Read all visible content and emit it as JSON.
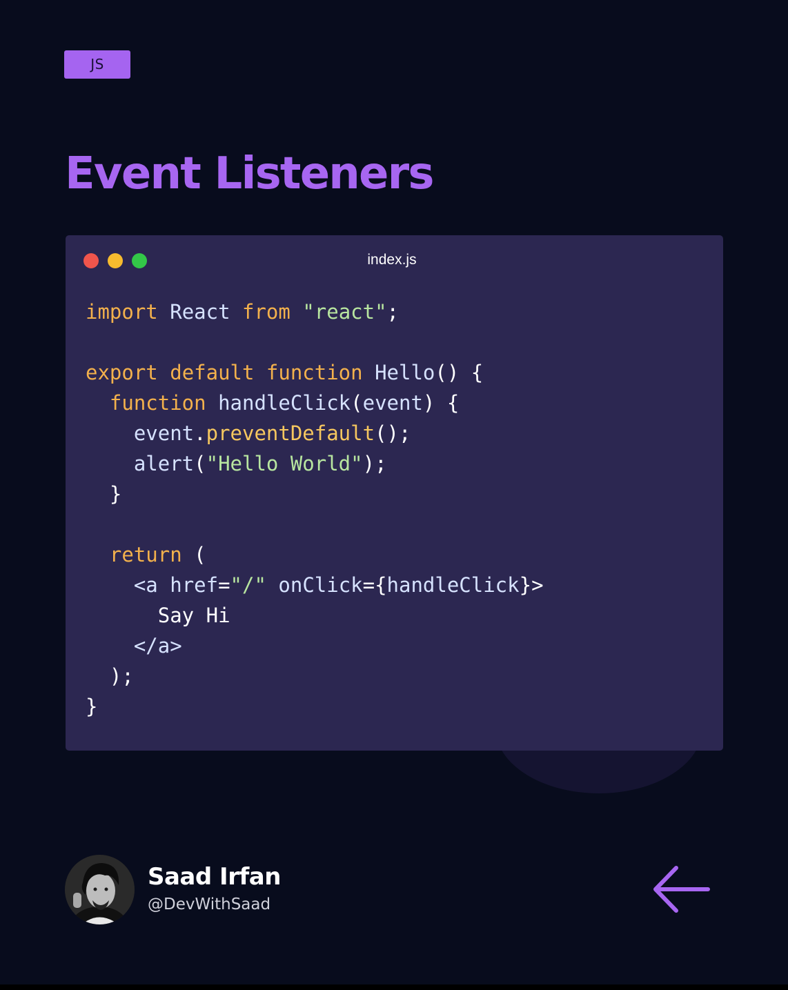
{
  "tag": {
    "label": "JS"
  },
  "title": "Event Listeners",
  "editor": {
    "file_name": "index.js",
    "lines": [
      [
        {
          "t": "import",
          "c": "kw"
        },
        {
          "t": " ",
          "c": "id"
        },
        {
          "t": "React",
          "c": "id"
        },
        {
          "t": " ",
          "c": "id"
        },
        {
          "t": "from",
          "c": "kw"
        },
        {
          "t": " ",
          "c": "id"
        },
        {
          "t": "\"react\"",
          "c": "str"
        },
        {
          "t": ";",
          "c": "punct"
        }
      ],
      [],
      [
        {
          "t": "export",
          "c": "kw"
        },
        {
          "t": " ",
          "c": "id"
        },
        {
          "t": "default",
          "c": "kw"
        },
        {
          "t": " ",
          "c": "id"
        },
        {
          "t": "function",
          "c": "kw"
        },
        {
          "t": " ",
          "c": "id"
        },
        {
          "t": "Hello",
          "c": "id"
        },
        {
          "t": "() {",
          "c": "punct"
        }
      ],
      [
        {
          "t": "  ",
          "c": "id"
        },
        {
          "t": "function",
          "c": "kw"
        },
        {
          "t": " ",
          "c": "id"
        },
        {
          "t": "handleClick",
          "c": "id"
        },
        {
          "t": "(",
          "c": "punct"
        },
        {
          "t": "event",
          "c": "id"
        },
        {
          "t": ") {",
          "c": "punct"
        }
      ],
      [
        {
          "t": "    ",
          "c": "id"
        },
        {
          "t": "event",
          "c": "id"
        },
        {
          "t": ".",
          "c": "punct"
        },
        {
          "t": "preventDefault",
          "c": "fn"
        },
        {
          "t": "();",
          "c": "punct"
        }
      ],
      [
        {
          "t": "    ",
          "c": "id"
        },
        {
          "t": "alert",
          "c": "id"
        },
        {
          "t": "(",
          "c": "punct"
        },
        {
          "t": "\"Hello World\"",
          "c": "str"
        },
        {
          "t": ");",
          "c": "punct"
        }
      ],
      [
        {
          "t": "  }",
          "c": "punct"
        }
      ],
      [],
      [
        {
          "t": "  ",
          "c": "id"
        },
        {
          "t": "return",
          "c": "kw"
        },
        {
          "t": " (",
          "c": "punct"
        }
      ],
      [
        {
          "t": "    ",
          "c": "id"
        },
        {
          "t": "<a",
          "c": "id"
        },
        {
          "t": " ",
          "c": "id"
        },
        {
          "t": "href",
          "c": "id"
        },
        {
          "t": "=",
          "c": "punct"
        },
        {
          "t": "\"/\"",
          "c": "str"
        },
        {
          "t": " ",
          "c": "id"
        },
        {
          "t": "onClick",
          "c": "id"
        },
        {
          "t": "={",
          "c": "punct"
        },
        {
          "t": "handleClick",
          "c": "id"
        },
        {
          "t": "}>",
          "c": "punct"
        }
      ],
      [
        {
          "t": "      ",
          "c": "id"
        },
        {
          "t": "Say Hi",
          "c": "punct"
        }
      ],
      [
        {
          "t": "    ",
          "c": "id"
        },
        {
          "t": "</a>",
          "c": "id"
        }
      ],
      [
        {
          "t": "  );",
          "c": "punct"
        }
      ],
      [
        {
          "t": "}",
          "c": "punct"
        }
      ]
    ]
  },
  "author": {
    "name": "Saad Irfan",
    "handle": "@DevWithSaad"
  },
  "icons": {
    "back": "arrow-left-icon",
    "avatar": "avatar-photo"
  },
  "colors": {
    "background": "#080c1d",
    "accent": "#a766f1",
    "editor_bg": "#2c2751",
    "keyword": "#f3b14c",
    "string": "#b8e6a0",
    "function_call": "#f6c75f",
    "identifier": "#d6e2ff"
  }
}
